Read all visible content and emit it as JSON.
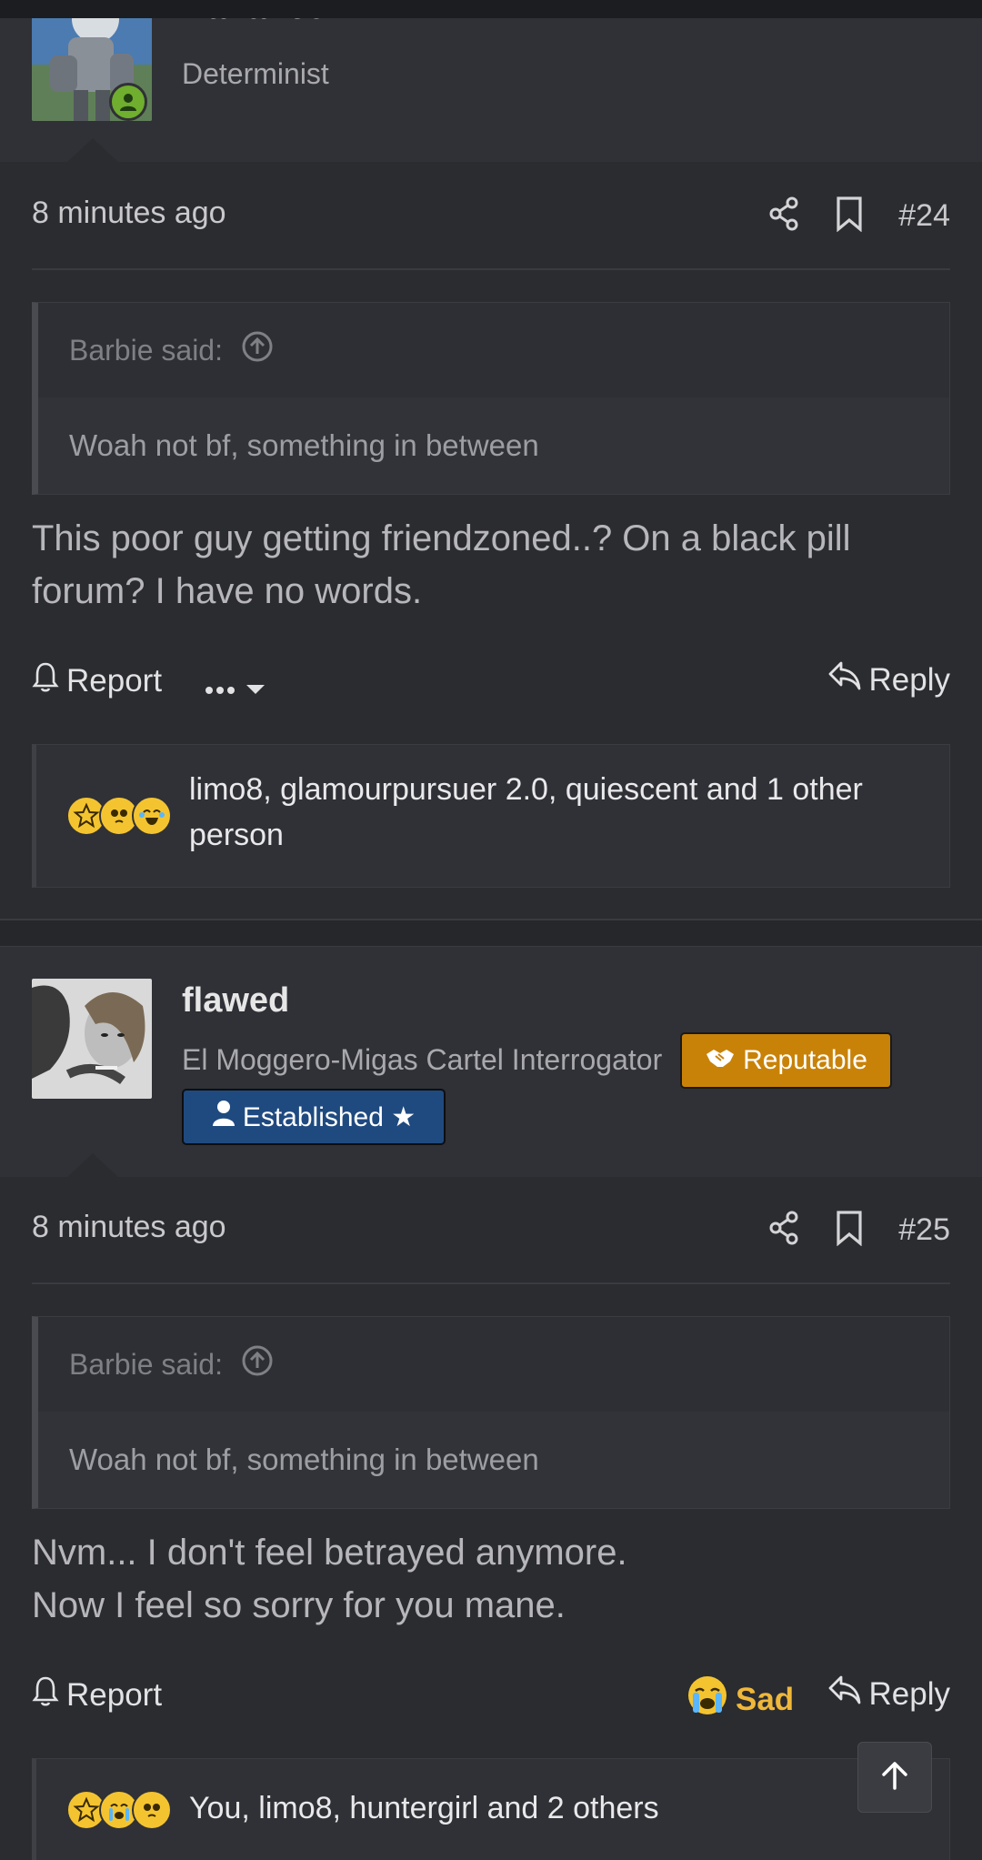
{
  "post24": {
    "author": {
      "name": "fraflancel",
      "title": "Determinist"
    },
    "date": "8 minutes ago",
    "number": "#24",
    "quote": {
      "author_label": "Barbie said:",
      "text": "Woah not bf, something in between"
    },
    "body_lines": [
      "This poor guy getting friendzoned..? On a black pill",
      "forum? I have no words."
    ],
    "actions": {
      "report": "Report",
      "reply": "Reply"
    },
    "reactions": {
      "text_line1": "limo8, glamourpursuer 2.0, quiescent and 1 other",
      "text_line2": "person"
    }
  },
  "post25": {
    "author": {
      "name": "flawed",
      "title": "El Moggero-Migas Cartel Interrogator",
      "badge_reputable": "Reputable",
      "badge_established": "Established ★"
    },
    "date": "8 minutes ago",
    "number": "#25",
    "quote": {
      "author_label": "Barbie said:",
      "text": "Woah not bf, something in between"
    },
    "body_lines": [
      "Nvm... I don't feel betrayed anymore.",
      "Now I feel so sorry for you mane."
    ],
    "actions": {
      "report": "Report",
      "reaction": "Sad",
      "reply": "Reply"
    },
    "reactions": {
      "text_line1": "You, limo8, huntergirl and 2 others"
    }
  },
  "icons": {
    "share": "share-icon",
    "bookmark": "bookmark-icon",
    "bell": "bell-icon",
    "reply": "reply-icon",
    "more": "ellipsis-icon",
    "scroll_top": "arrow-up-icon"
  },
  "colors": {
    "background": "#2b2c30",
    "reputable_badge": "#c98208",
    "established_badge": "#1f4a80",
    "sad_reaction": "#f0b83a",
    "online": "#6fae2e"
  }
}
